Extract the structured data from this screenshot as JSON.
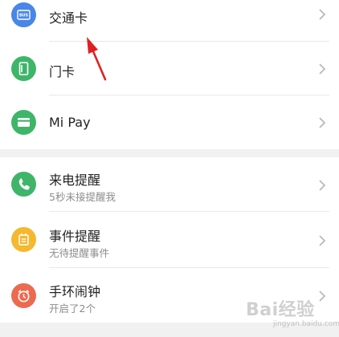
{
  "section1": {
    "items": [
      {
        "title": "交通卡",
        "icon": "bus-card-icon",
        "color": "#4a86e8"
      },
      {
        "title": "门卡",
        "icon": "door-card-icon",
        "color": "#3fb56a"
      },
      {
        "title": "Mi Pay",
        "icon": "wallet-card-icon",
        "color": "#3fb56a"
      }
    ]
  },
  "section2": {
    "items": [
      {
        "title": "来电提醒",
        "subtitle": "5秒未接提醒我",
        "icon": "phone-icon",
        "color": "#3fb56a"
      },
      {
        "title": "事件提醒",
        "subtitle": "无待提醒事件",
        "icon": "event-icon",
        "color": "#f5b82e"
      },
      {
        "title": "手环闹钟",
        "subtitle": "开启了2个",
        "icon": "alarm-clock-icon",
        "color": "#ec6a4f"
      }
    ]
  },
  "bus_icon_text": "BUS",
  "watermark": {
    "text": "Bai经验",
    "url": "jingyan.baidu.com"
  }
}
